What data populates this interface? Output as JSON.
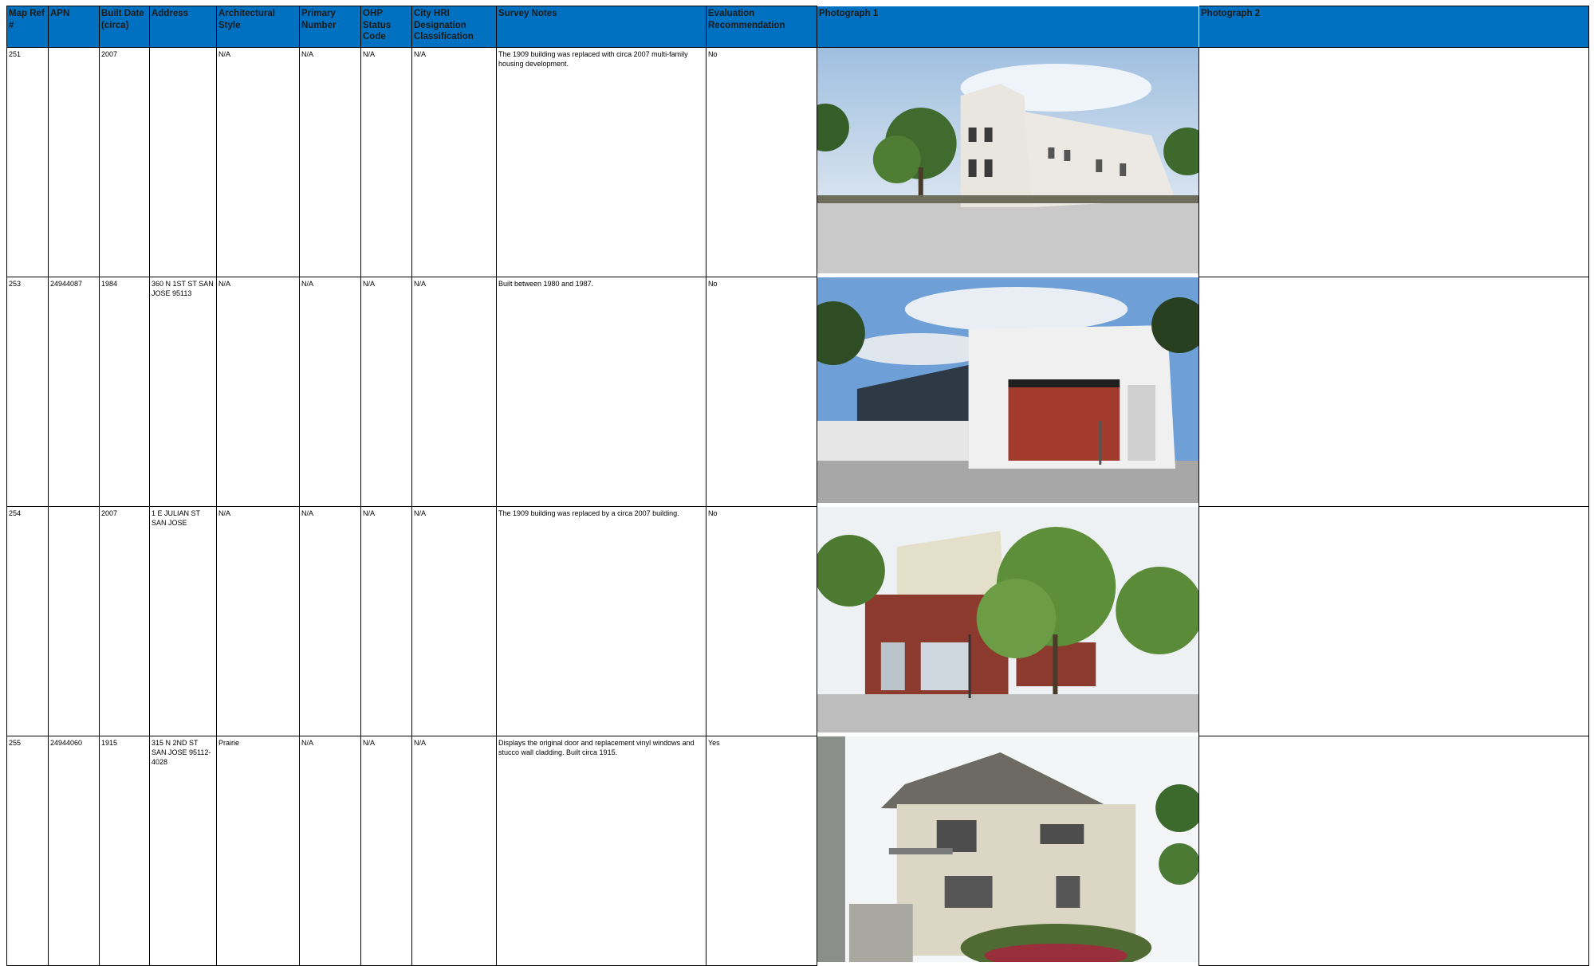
{
  "table": {
    "headers": [
      "Map Ref #",
      "APN",
      "Built Date (circa)",
      "Address",
      "Architectural Style",
      "Primary Number",
      "OHP Status Code",
      "City HRI Designation Classification",
      "Survey Notes",
      "Evaluation Recommendation",
      "Photograph 1",
      "Photograph 2"
    ],
    "rows": [
      {
        "map_ref": "251",
        "apn": "",
        "built": "2007",
        "address": "",
        "style": "N/A",
        "primary": "N/A",
        "ohp": "N/A",
        "hri": "N/A",
        "notes": "The 1909 building was replaced with circa 2007 multi-family housing development.",
        "eval": "No",
        "photo1": "white-spanish-style-apartment-building",
        "photo2": ""
      },
      {
        "map_ref": "253",
        "apn": "24944087",
        "built": "1984",
        "address": "360 N 1ST ST SAN JOSE 95113",
        "style": "N/A",
        "primary": "N/A",
        "ohp": "N/A",
        "hri": "N/A",
        "notes": "Built between 1980 and 1987.",
        "eval": "No",
        "photo1": "white-modern-building-red-panel",
        "photo2": ""
      },
      {
        "map_ref": "254",
        "apn": "",
        "built": "2007",
        "address": "1 E JULIAN ST SAN JOSE",
        "style": "N/A",
        "primary": "N/A",
        "ohp": "N/A",
        "hri": "N/A",
        "notes": "The 1909 building was replaced by a circa 2007 building.",
        "eval": "No",
        "photo1": "brick-mixed-use-building-with-trees",
        "photo2": ""
      },
      {
        "map_ref": "255",
        "apn": "24944060",
        "built": "1915",
        "address": "315 N 2ND ST SAN JOSE 95112-4028",
        "style": "Prairie",
        "primary": "N/A",
        "ohp": "N/A",
        "hri": "N/A",
        "notes": "Displays the original door and replacement vinyl windows and stucco wall cladding. Built circa 1915.",
        "eval": "Yes",
        "photo1": "prairie-style-two-story-house",
        "photo2": ""
      }
    ]
  },
  "colors": {
    "header_bg": "#0070c0",
    "grid": "#000000"
  }
}
